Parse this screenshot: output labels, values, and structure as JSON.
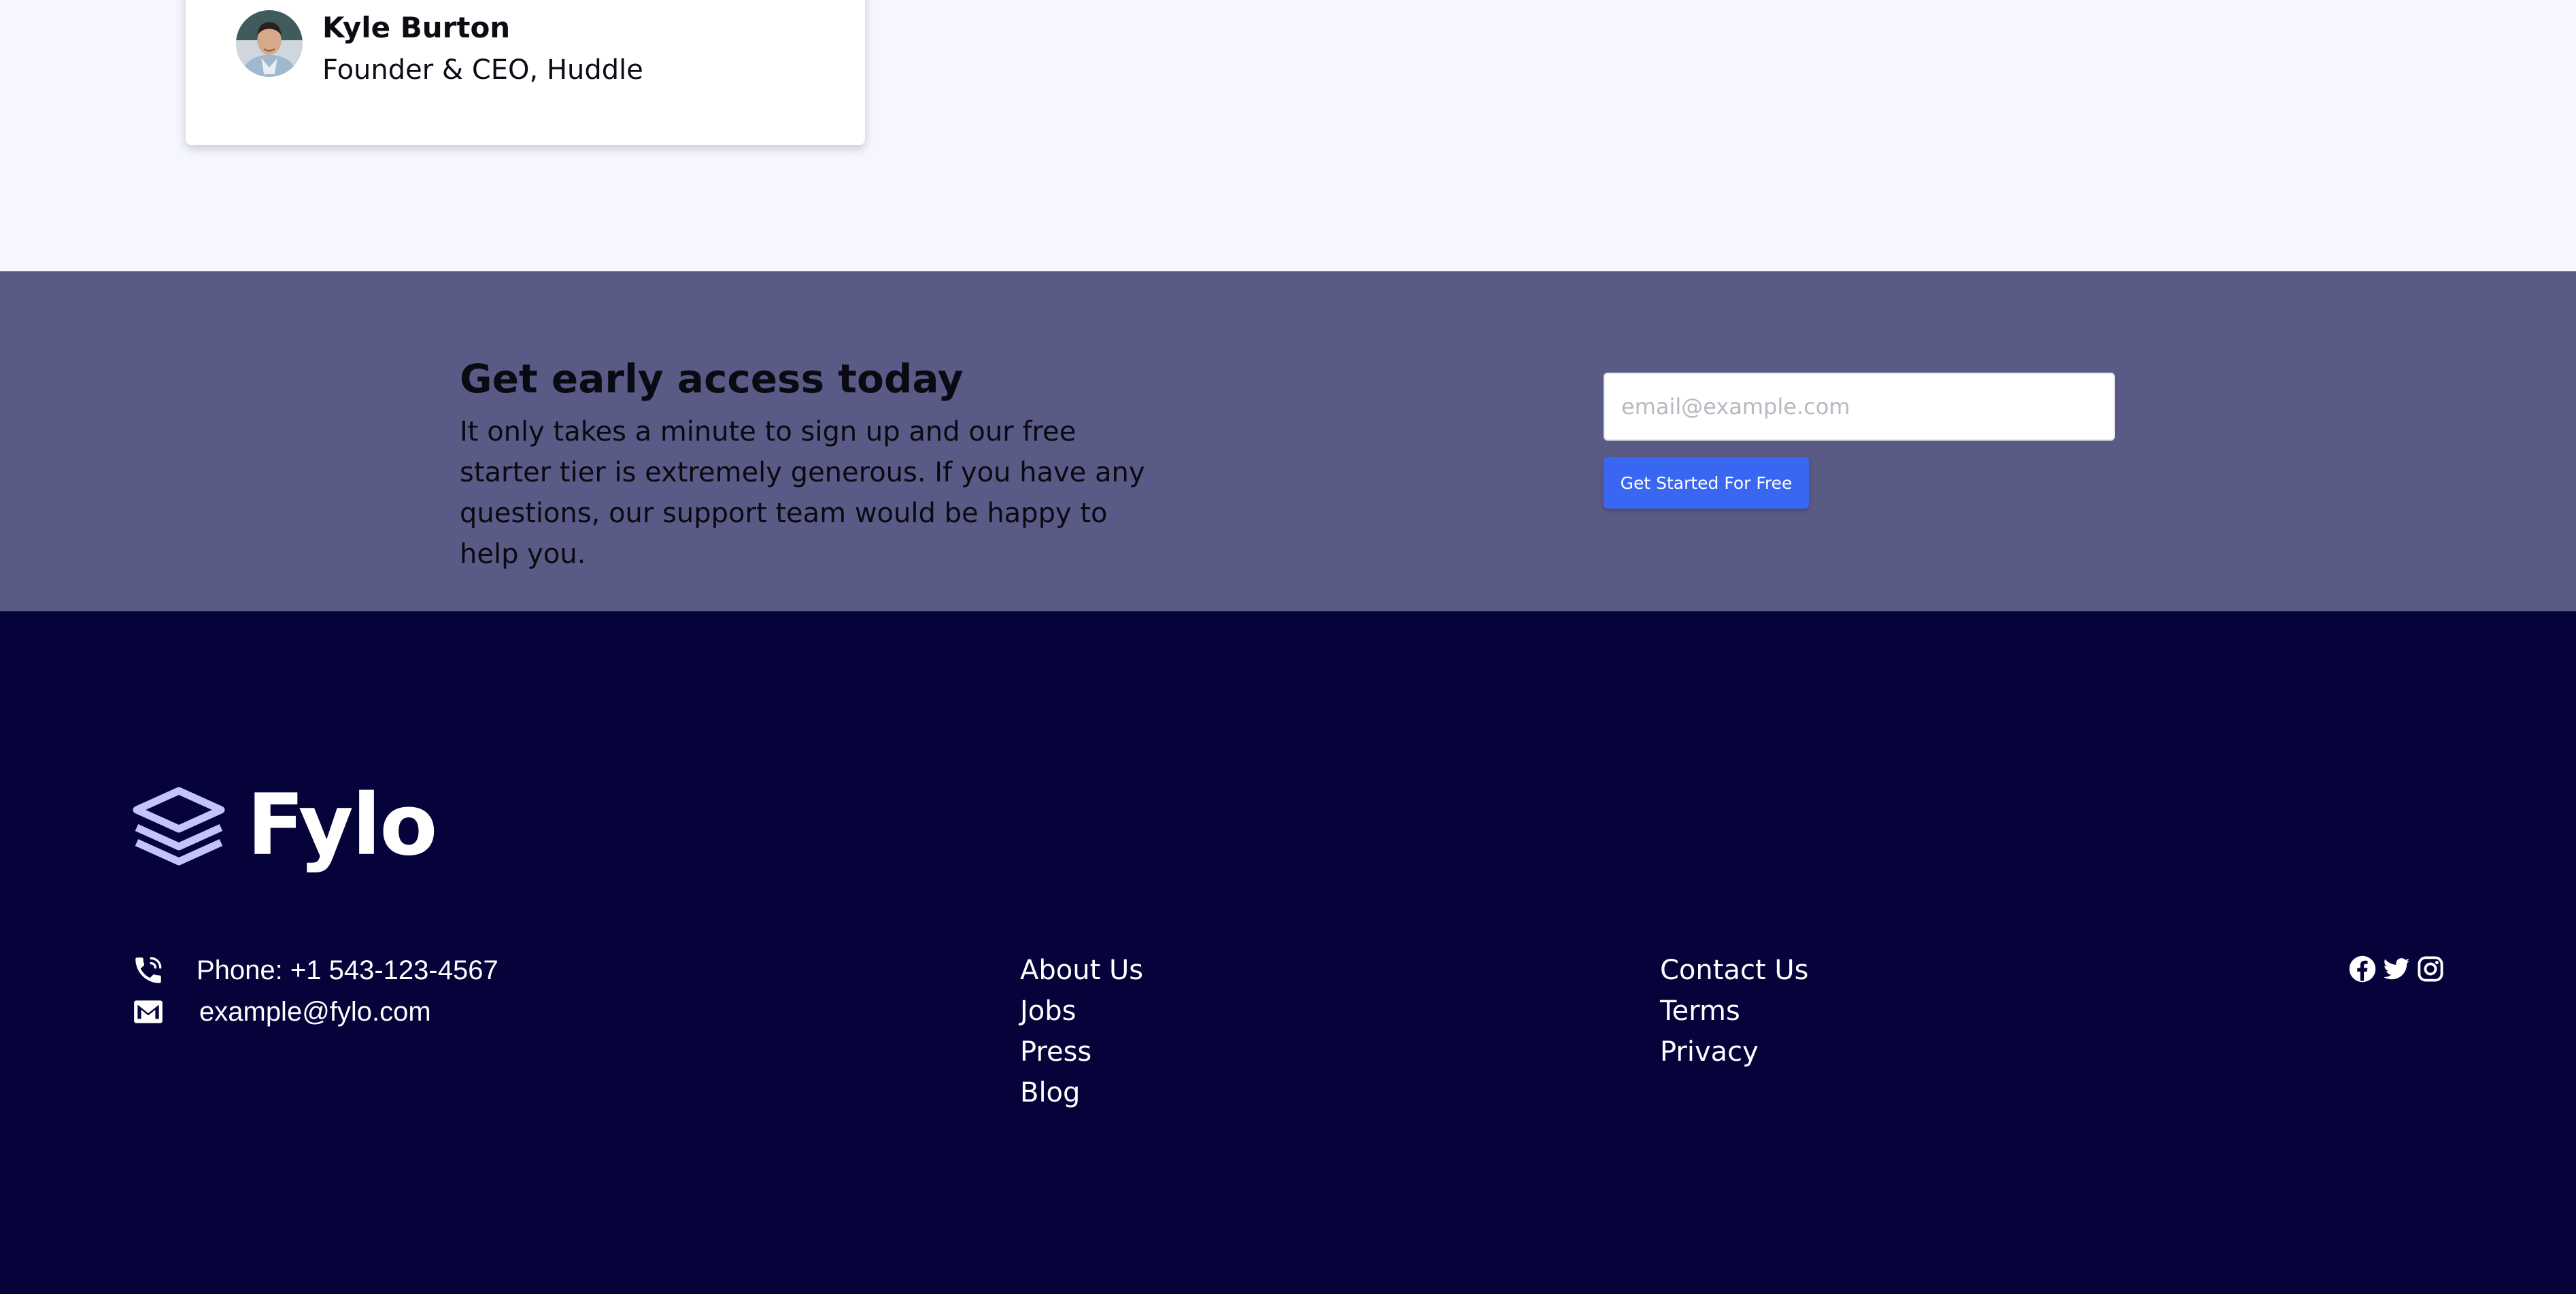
{
  "testimonial": {
    "author_name": "Kyle Burton",
    "author_title": "Founder & CEO, Huddle"
  },
  "cta": {
    "heading": "Get early access today",
    "description": "It only takes a minute to sign up and our free starter tier is extremely generous. If you have any questions, our support team would be happy to help you.",
    "email_placeholder": "email@example.com",
    "button_label": "Get Started For Free"
  },
  "footer": {
    "brand_name": "Fylo",
    "phone": "Phone: +1 543-123-4567",
    "email": "example@fylo.com",
    "links_col1": [
      "About Us",
      "Jobs",
      "Press",
      "Blog"
    ],
    "links_col2": [
      "Contact Us",
      "Terms",
      "Privacy"
    ],
    "social_icons": [
      "facebook-icon",
      "twitter-icon",
      "instagram-icon"
    ]
  },
  "colors": {
    "testimonial_bg": "#f5f6fe",
    "cta_bg": "#5a5a87",
    "footer_bg": "#06023a",
    "button_blue": "#3a67f2",
    "logo_lavender": "#c5c3fc"
  }
}
